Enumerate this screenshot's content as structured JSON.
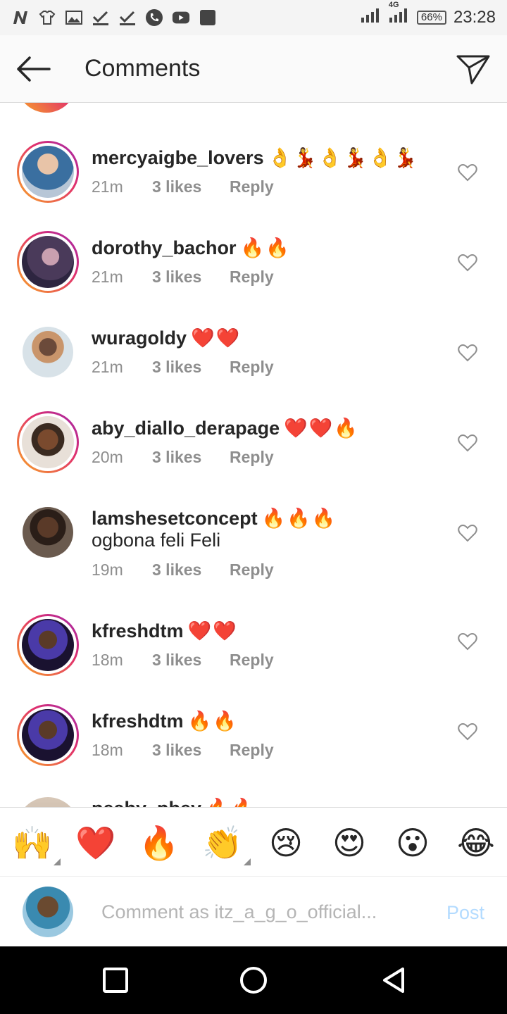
{
  "status_bar": {
    "time": "23:28",
    "battery": "66%",
    "network": "4G",
    "icons": [
      "n-icon",
      "shirt-icon",
      "image-icon",
      "check-icon",
      "check-icon",
      "phone-icon",
      "youtube-icon",
      "app-icon"
    ]
  },
  "header": {
    "title": "Comments"
  },
  "comments": [
    {
      "username": "mercyaigbe_lovers",
      "emoji": "👌💃👌💃👌💃",
      "text": "",
      "time": "21m",
      "likes": "3 likes",
      "reply": "Reply"
    },
    {
      "username": "dorothy_bachor",
      "emoji": "🔥🔥",
      "text": "",
      "time": "21m",
      "likes": "3 likes",
      "reply": "Reply"
    },
    {
      "username": "wuragoldy",
      "emoji": "❤️❤️",
      "text": "",
      "time": "21m",
      "likes": "3 likes",
      "reply": "Reply"
    },
    {
      "username": "aby_diallo_derapage",
      "emoji": "❤️❤️🔥",
      "text": "",
      "time": "20m",
      "likes": "3 likes",
      "reply": "Reply"
    },
    {
      "username": "lamshesetconcept",
      "emoji": "🔥🔥🔥",
      "text": "ogbona feli Feli",
      "time": "19m",
      "likes": "3 likes",
      "reply": "Reply"
    },
    {
      "username": "kfreshdtm",
      "emoji": "❤️❤️",
      "text": "",
      "time": "18m",
      "likes": "3 likes",
      "reply": "Reply"
    },
    {
      "username": "kfreshdtm",
      "emoji": "🔥🔥",
      "text": "",
      "time": "18m",
      "likes": "3 likes",
      "reply": "Reply"
    }
  ],
  "partial_comment": {
    "username": "peaby_pbey",
    "emoji": "🔥🔥"
  },
  "emoji_bar": [
    "🙌",
    "❤️",
    "🔥",
    "👏",
    "😢",
    "😍",
    "😮",
    "😂"
  ],
  "comment_box": {
    "placeholder": "Comment as itz_a_g_o_official...",
    "post_label": "Post"
  },
  "colors": {
    "accent_post": "#b3dbff",
    "text_primary": "#262626",
    "text_secondary": "#8e8e8e",
    "story_ring_start": "#f9a825",
    "story_ring_end": "#9c27b0"
  }
}
